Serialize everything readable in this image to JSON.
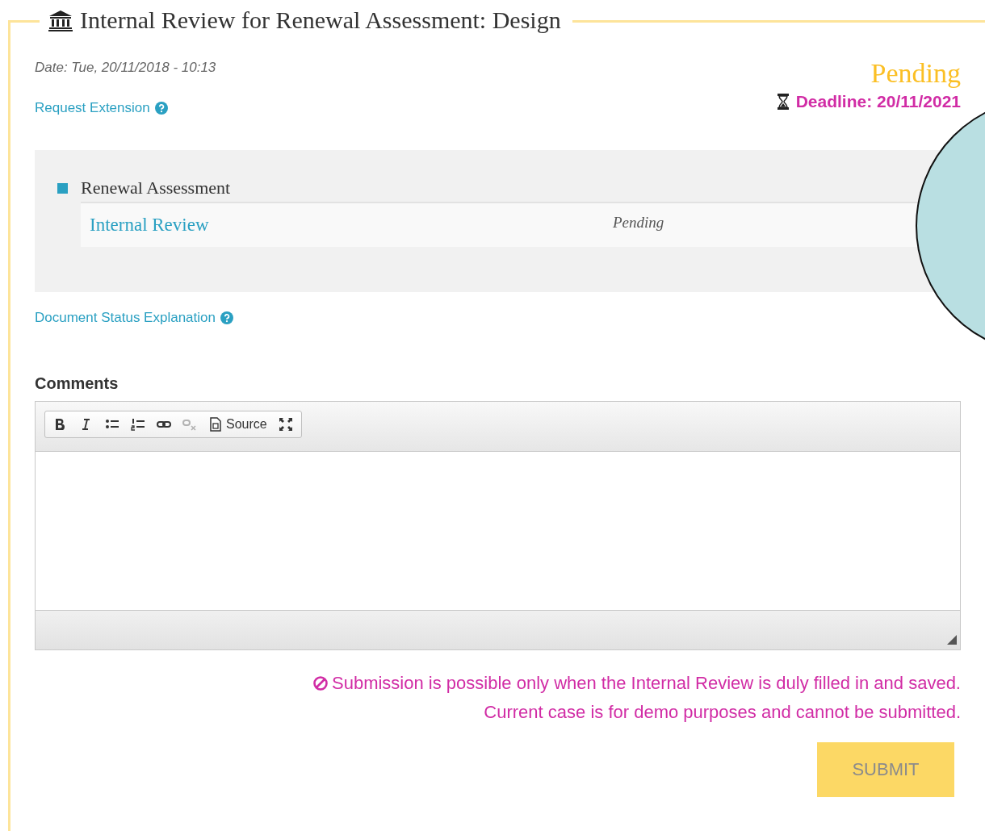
{
  "panel": {
    "title": "Internal Review for Renewal Assessment: Design"
  },
  "meta": {
    "date": "Date: Tue, 20/11/2018 - 10:13",
    "extension_link": "Request Extension",
    "status": "Pending",
    "deadline": "Deadline: 20/11/2021"
  },
  "workflow": {
    "heading": "Renewal Assessment",
    "steps": [
      {
        "name": "Internal Review",
        "status": "Pending"
      }
    ]
  },
  "status_link": "Document Status Explanation",
  "comments": {
    "label": "Comments",
    "toolbar": [
      {
        "kind": "bold",
        "disabled": false
      },
      {
        "kind": "italic",
        "disabled": false
      },
      {
        "kind": "bullets",
        "disabled": false
      },
      {
        "kind": "numbers",
        "disabled": false
      },
      {
        "kind": "link",
        "disabled": false
      },
      {
        "kind": "unlink",
        "disabled": true
      },
      {
        "kind": "source",
        "label": "Source",
        "disabled": false
      },
      {
        "kind": "maximize",
        "disabled": false
      }
    ]
  },
  "notice": [
    "Submission is possible only when the Internal Review is duly filled in and saved.",
    "Current case is for demo purposes and cannot be submitted."
  ],
  "submit": {
    "label": "SUBMIT",
    "disabled": true
  }
}
